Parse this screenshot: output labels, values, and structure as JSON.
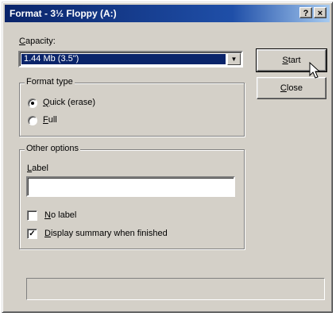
{
  "window": {
    "title": "Format - 3½ Floppy (A:)",
    "help_button": "?",
    "close_button": "×"
  },
  "capacity": {
    "label": "Capacity:",
    "selected": "1.44 Mb (3.5\")"
  },
  "format_type": {
    "legend": "Format type",
    "options": [
      {
        "label": "Quick (erase)",
        "selected": true
      },
      {
        "label": "Full",
        "selected": false
      }
    ]
  },
  "other_options": {
    "legend": "Other options",
    "label_caption": "Label",
    "label_value": "",
    "no_label": {
      "label": "No label",
      "checked": false
    },
    "display_summary": {
      "label": "Display summary when finished",
      "checked": true
    }
  },
  "buttons": {
    "start": "Start",
    "close": "Close"
  },
  "progress": {
    "value": 0
  },
  "colors": {
    "title_bar": "#0a246a",
    "face": "#d4d0c8",
    "selection": "#0a246a"
  }
}
